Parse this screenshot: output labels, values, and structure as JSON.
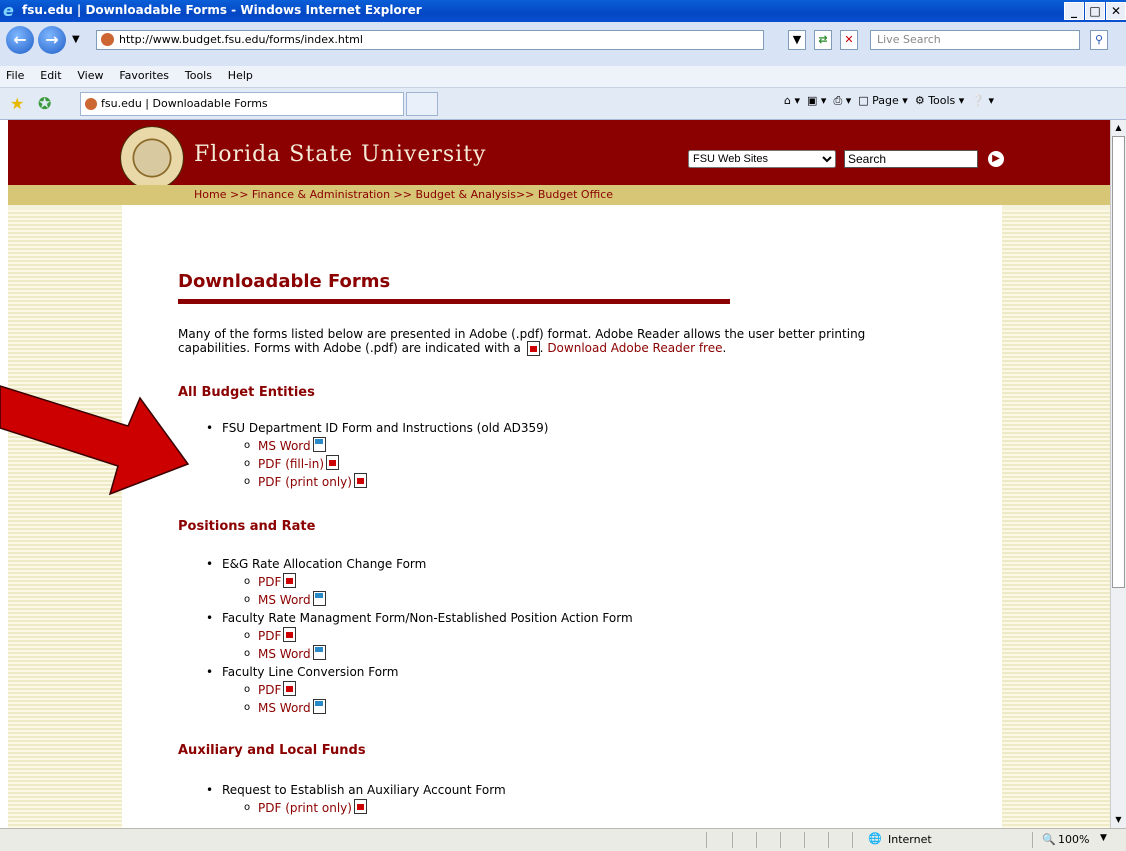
{
  "window": {
    "title": "fsu.edu | Downloadable Forms - Windows Internet Explorer",
    "controls": [
      "_",
      "□",
      "✕"
    ]
  },
  "address_bar": {
    "url": "http://www.budget.fsu.edu/forms/index.html",
    "search_placeholder": "Live Search"
  },
  "menu": [
    "File",
    "Edit",
    "View",
    "Favorites",
    "Tools",
    "Help"
  ],
  "tab": {
    "label": "fsu.edu | Downloadable Forms"
  },
  "command_bar": {
    "page_label": "Page",
    "tools_label": "Tools"
  },
  "site": {
    "name": "Florida State University",
    "sites_select": "FSU Web Sites",
    "search_value": "Search",
    "breadcrumb": "Home >> Finance & Administration >> Budget & Analysis>> Budget Office"
  },
  "page": {
    "title": "Downloadable Forms",
    "intro_1": "Many of the forms listed below are presented in Adobe (.pdf) format.  Adobe Reader allows the user better printing capabilities.  Forms with Adobe (.pdf) are indicated with a",
    "intro_link": "Download Adobe Reader free",
    "sections": [
      {
        "heading": "All Budget Entities",
        "items": [
          {
            "label": "FSU Department ID Form and Instructions (old AD359)",
            "links": [
              "MS Word",
              "PDF (fill-in)",
              "PDF (print only)"
            ]
          }
        ]
      },
      {
        "heading": "Positions and Rate",
        "items": [
          {
            "label": "E&G Rate Allocation Change Form",
            "links": [
              "PDF",
              "MS Word"
            ]
          },
          {
            "label": "Faculty Rate Managment Form/Non-Established Position Action Form",
            "links": [
              "PDF",
              "MS Word"
            ]
          },
          {
            "label": "Faculty Line Conversion Form",
            "links": [
              "PDF",
              "MS Word"
            ]
          }
        ]
      },
      {
        "heading": "Auxiliary and Local Funds",
        "items": [
          {
            "label": "Request to Establish an Auxiliary Account Form",
            "links": [
              "PDF (print only)"
            ]
          }
        ]
      }
    ]
  },
  "status_bar": {
    "zone": "Internet",
    "zoom": "100%"
  },
  "colors": {
    "brand": "#8b0000",
    "gold": "#d6c676",
    "arrow": "#cc0000"
  }
}
